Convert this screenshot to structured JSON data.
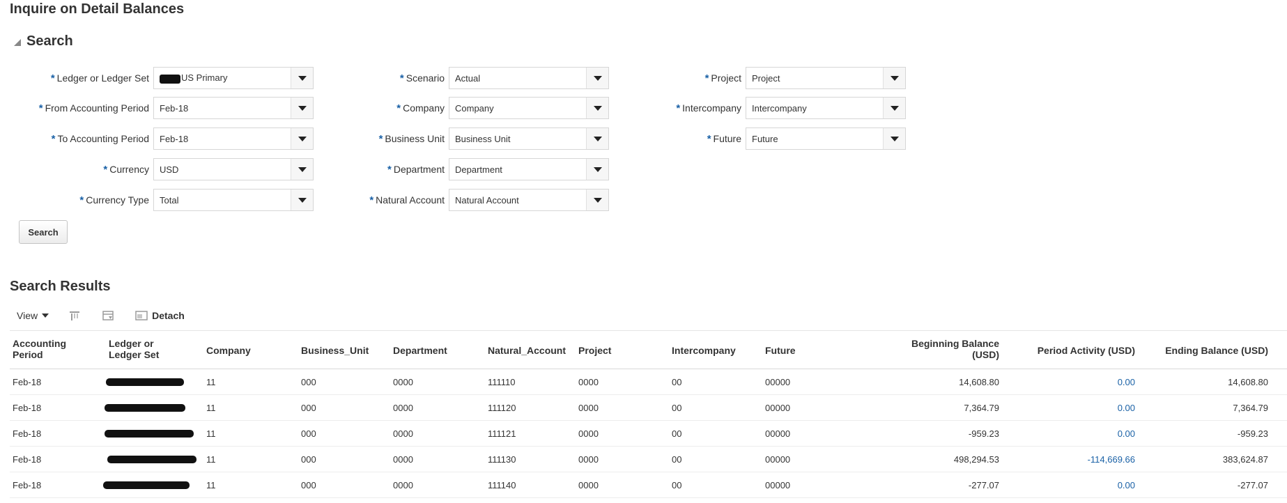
{
  "page": {
    "title": "Inquire on Detail Balances"
  },
  "search": {
    "title": "Search",
    "button_label": "Search",
    "fields_col1": [
      {
        "label": "Ledger or Ledger Set",
        "value": "US Primary",
        "redacted_prefix": true
      },
      {
        "label": "From Accounting Period",
        "value": "Feb-18"
      },
      {
        "label": "To Accounting Period",
        "value": "Feb-18"
      },
      {
        "label": "Currency",
        "value": "USD"
      },
      {
        "label": "Currency Type",
        "value": "Total"
      }
    ],
    "fields_col2": [
      {
        "label": "Scenario",
        "value": "Actual"
      },
      {
        "label": "Company",
        "value": "Company"
      },
      {
        "label": "Business Unit",
        "value": "Business Unit"
      },
      {
        "label": "Department",
        "value": "Department"
      },
      {
        "label": "Natural Account",
        "value": "Natural Account"
      }
    ],
    "fields_col3": [
      {
        "label": "Project",
        "value": "Project"
      },
      {
        "label": "Intercompany",
        "value": "Intercompany"
      },
      {
        "label": "Future",
        "value": "Future"
      }
    ],
    "required_marker": "*"
  },
  "results": {
    "title": "Search Results",
    "toolbar": {
      "view_label": "View",
      "detach_label": "Detach"
    },
    "columns": [
      "Accounting Period",
      "Ledger or Ledger Set",
      "Company",
      "Business_Unit",
      "Department",
      "Natural_Account",
      "Project",
      "Intercompany",
      "Future",
      "Beginning Balance (USD)",
      "Period Activity (USD)",
      "Ending Balance (USD)"
    ],
    "column_header_lines": {
      "accounting_period": [
        "Accounting",
        "Period"
      ],
      "ledger": [
        "Ledger or",
        "Ledger Set"
      ],
      "beginning_balance": [
        "Beginning Balance",
        "(USD)"
      ]
    },
    "rows": [
      {
        "period": "Feb-18",
        "company": "11",
        "business_unit": "000",
        "department": "0000",
        "natural_account": "111110",
        "project": "0000",
        "intercompany": "00",
        "future": "00000",
        "beginning": "14,608.80",
        "activity": "0.00",
        "ending": "14,608.80"
      },
      {
        "period": "Feb-18",
        "company": "11",
        "business_unit": "000",
        "department": "0000",
        "natural_account": "111120",
        "project": "0000",
        "intercompany": "00",
        "future": "00000",
        "beginning": "7,364.79",
        "activity": "0.00",
        "ending": "7,364.79"
      },
      {
        "period": "Feb-18",
        "company": "11",
        "business_unit": "000",
        "department": "0000",
        "natural_account": "111121",
        "project": "0000",
        "intercompany": "00",
        "future": "00000",
        "beginning": "-959.23",
        "activity": "0.00",
        "ending": "-959.23"
      },
      {
        "period": "Feb-18",
        "company": "11",
        "business_unit": "000",
        "department": "0000",
        "natural_account": "111130",
        "project": "0000",
        "intercompany": "00",
        "future": "00000",
        "beginning": "498,294.53",
        "activity": "-114,669.66",
        "ending": "383,624.87"
      },
      {
        "period": "Feb-18",
        "company": "11",
        "business_unit": "000",
        "department": "0000",
        "natural_account": "111140",
        "project": "0000",
        "intercompany": "00",
        "future": "00000",
        "beginning": "-277.07",
        "activity": "0.00",
        "ending": "-277.07"
      }
    ]
  },
  "colors": {
    "required": "#1a61a6",
    "link": "#1a61a6",
    "redaction": "#111111"
  }
}
